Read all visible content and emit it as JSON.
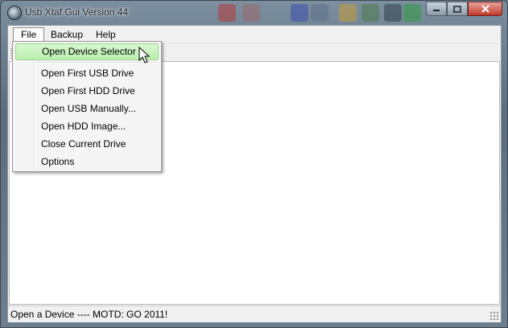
{
  "window": {
    "title": "Usb Xtaf Gui Version 44"
  },
  "menubar": {
    "items": [
      "File",
      "Backup",
      "Help"
    ]
  },
  "file_menu": {
    "items": [
      "Open Device Selector",
      "Open First USB Drive",
      "Open First HDD Drive",
      "Open USB Manually...",
      "Open HDD Image...",
      "Close  Current Drive",
      "Options"
    ],
    "highlighted": "Open Device Selector"
  },
  "statusbar": {
    "text": "Open a Device ---- MOTD: GO 2011!"
  },
  "colors": {
    "highlight": "#c6f2bc",
    "close_button": "#c0392b"
  },
  "icons": [
    "app-icon",
    "minimize-icon",
    "maximize-icon",
    "close-icon",
    "mouse-cursor-icon",
    "size-grip-icon"
  ]
}
